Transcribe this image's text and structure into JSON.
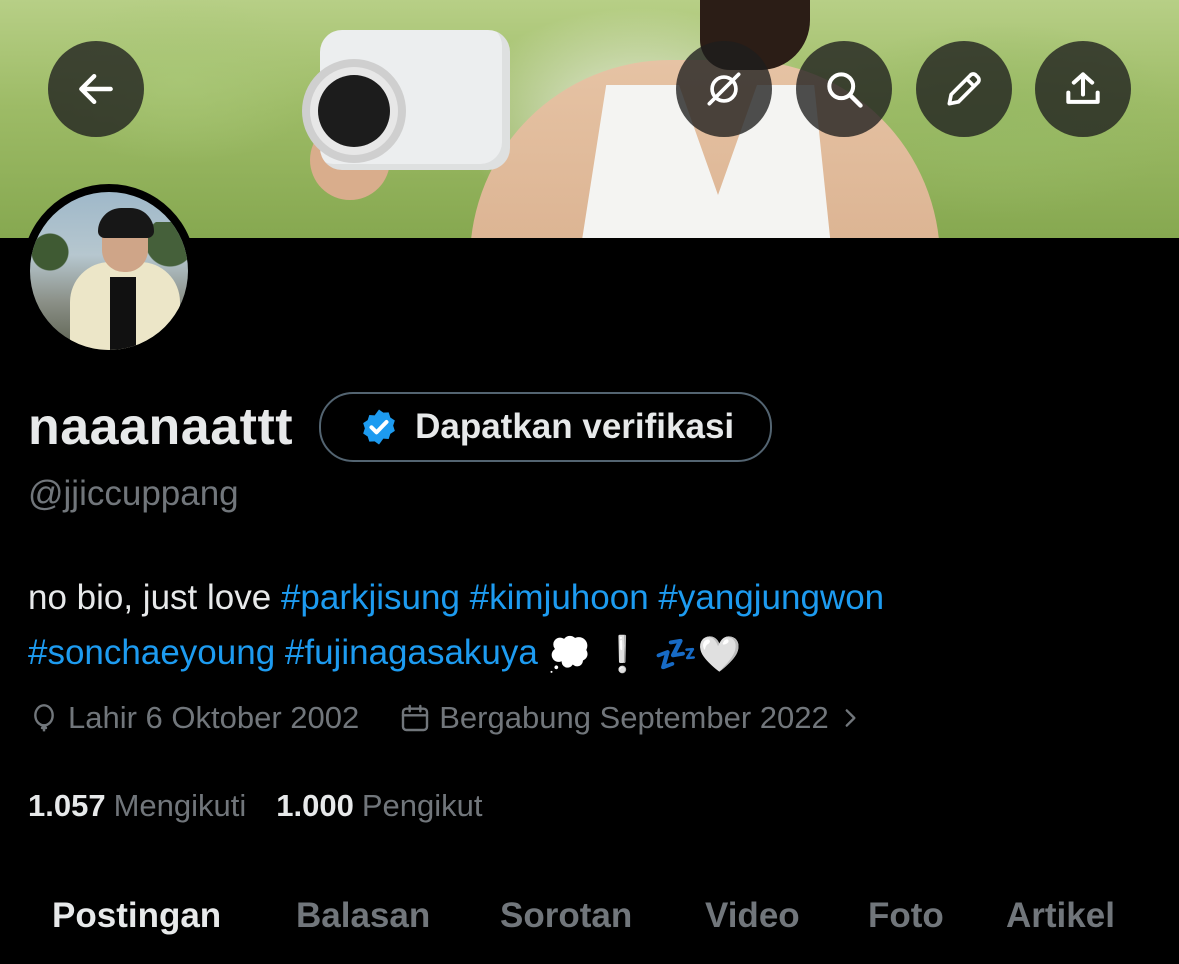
{
  "header": {
    "back_icon": "arrow-left-icon",
    "actions": [
      {
        "icon": "grok-icon"
      },
      {
        "icon": "search-icon"
      },
      {
        "icon": "pencil-icon"
      },
      {
        "icon": "share-icon"
      }
    ]
  },
  "profile": {
    "display_name": "naaanaattt",
    "verify_button_label": "Dapatkan verifikasi",
    "verify_icon_color": "#1d9bf0",
    "handle": "@jjiccuppang",
    "bio": {
      "prefix": "no bio, just love ",
      "hashtags_line1": [
        "#parkjisung",
        "#kimjuhoon",
        "#yangjungwon"
      ],
      "hashtags_line2": [
        "#sonchaeyoung",
        "#fujinagasakuya"
      ],
      "emojis": [
        "💭",
        "❕",
        "💤",
        "🤍"
      ]
    },
    "birthdate": "Lahir 6 Oktober 2002",
    "joined": "Bergabung September 2022",
    "following_count": "1.057",
    "following_label": "Mengikuti",
    "followers_count": "1.000",
    "followers_label": "Pengikut"
  },
  "tabs": [
    {
      "label": "Postingan",
      "active": true
    },
    {
      "label": "Balasan",
      "active": false
    },
    {
      "label": "Sorotan",
      "active": false
    },
    {
      "label": "Video",
      "active": false
    },
    {
      "label": "Foto",
      "active": false
    },
    {
      "label": "Artikel",
      "active": false
    }
  ],
  "colors": {
    "background": "#000000",
    "text_primary": "#e7e9ea",
    "text_secondary": "#71767b",
    "link": "#1d9bf0"
  }
}
